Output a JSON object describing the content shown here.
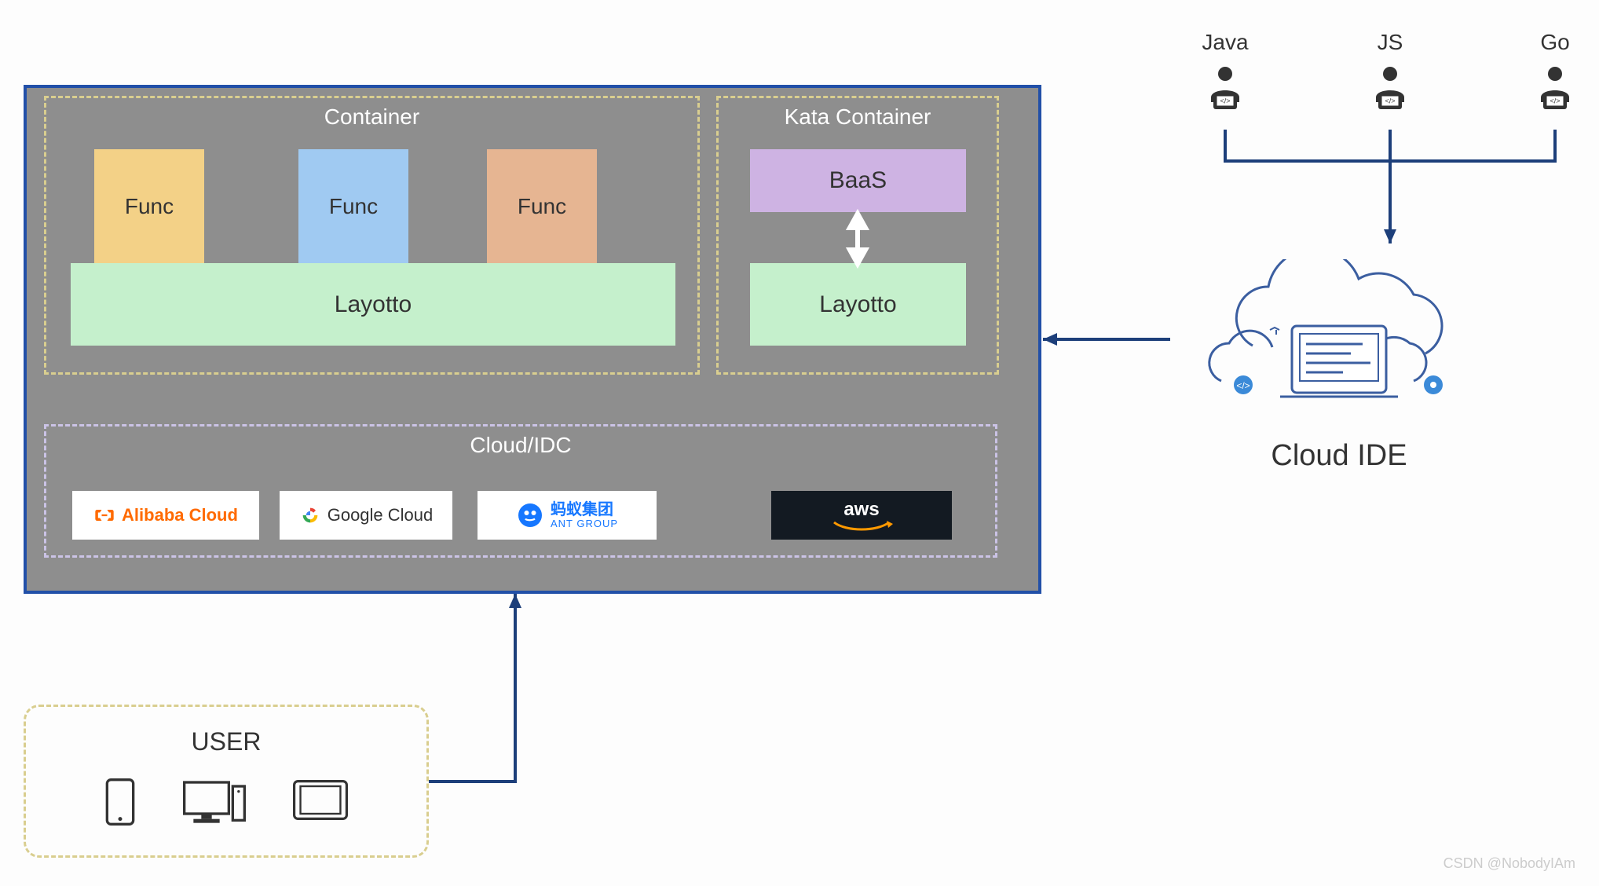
{
  "container": {
    "title": "Container",
    "funcs": [
      "Func",
      "Func",
      "Func"
    ],
    "layotto": "Layotto"
  },
  "kata": {
    "title": "Kata Container",
    "baas": "BaaS",
    "layotto": "Layotto"
  },
  "cloud": {
    "title": "Cloud/IDC",
    "providers": {
      "alibaba": "Alibaba Cloud",
      "google": "Google Cloud",
      "ant_zh": "蚂蚁集团",
      "ant_en": "ANT GROUP",
      "aws": "aws"
    }
  },
  "user": {
    "title": "USER"
  },
  "devs": {
    "java": "Java",
    "js": "JS",
    "go": "Go"
  },
  "cloud_ide": "Cloud IDE",
  "watermark": "CSDN @NobodyIAm"
}
